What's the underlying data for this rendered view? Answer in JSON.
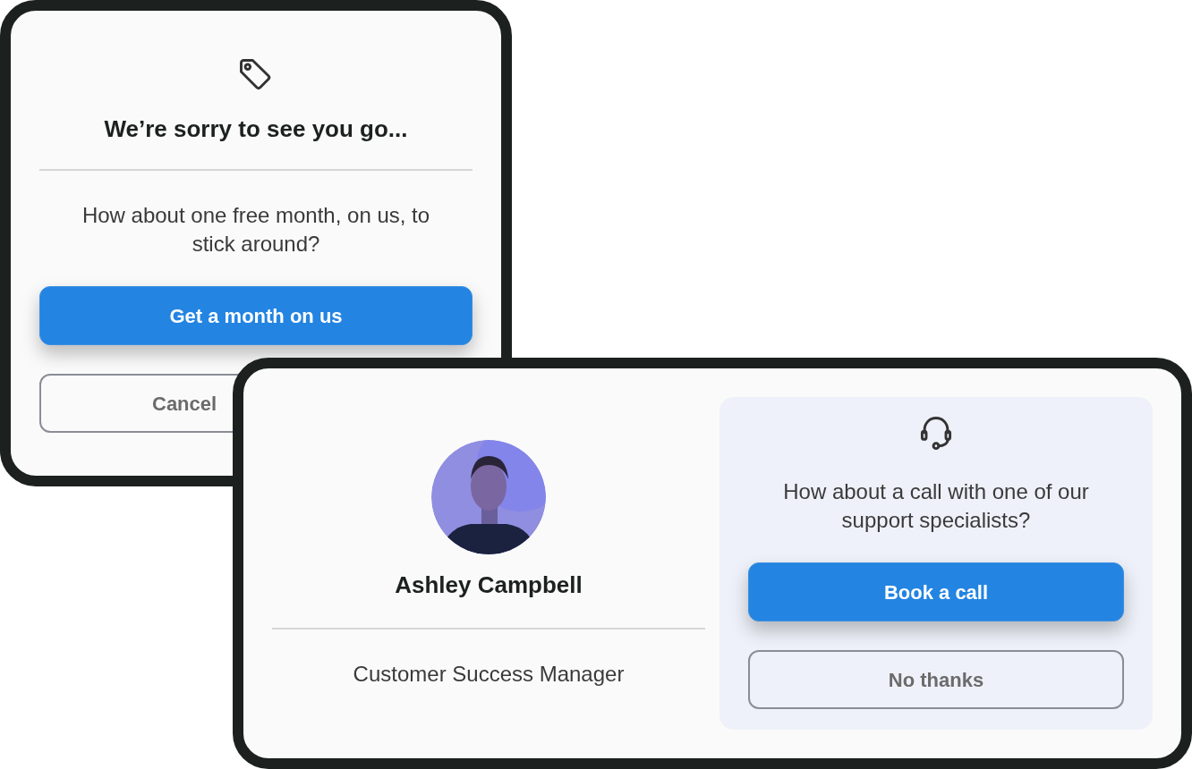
{
  "retention_offer": {
    "title": "We’re sorry to see you go...",
    "message": "How about one free month, on us, to stick around?",
    "buttons": [
      {
        "label": "Get a month on us",
        "kind": "primary"
      },
      {
        "label": "Cancel",
        "kind": "secondary"
      }
    ]
  },
  "support_offer": {
    "contact": {
      "name": "Ashley Campbell",
      "role": "Customer Success Manager"
    },
    "message": "How about a call with one of our support specialists?",
    "buttons": [
      {
        "label": "Book a call",
        "kind": "primary"
      },
      {
        "label": "No thanks",
        "kind": "secondary"
      }
    ]
  }
}
